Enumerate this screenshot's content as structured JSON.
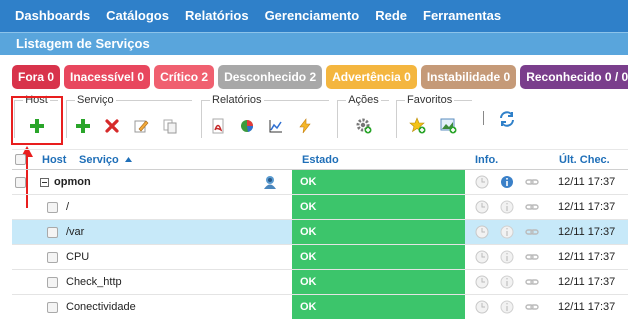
{
  "nav": [
    "Dashboards",
    "Catálogos",
    "Relatórios",
    "Gerenciamento",
    "Rede",
    "Ferramentas"
  ],
  "subheader": "Listagem de Serviços",
  "badges": [
    {
      "label": "Fora 0",
      "color": "#d8334b"
    },
    {
      "label": "Inacessível 0",
      "color": "#e8475e"
    },
    {
      "label": "Crítico 2",
      "color": "#f06070"
    },
    {
      "label": "Desconhecido 2",
      "color": "#a8a8a8"
    },
    {
      "label": "Advertência 0",
      "color": "#f4b63f"
    },
    {
      "label": "Instabilidade 0",
      "color": "#c59a78"
    },
    {
      "label": "Reconhecido 0 / 0",
      "color": "#7a3e8c"
    }
  ],
  "toolbar": {
    "host": "Host",
    "servico": "Serviço",
    "relatorios": "Relatórios",
    "acoes": "Ações",
    "favoritos": "Favoritos"
  },
  "grid": {
    "col_host": "Host",
    "col_servico": "Serviço",
    "col_estado": "Estado",
    "col_info": "Info.",
    "col_ult": "Últ. Chec.",
    "host_name": "opmon",
    "host_status": "OK",
    "host_time": "12/11 17:37",
    "rows": [
      {
        "name": "/",
        "status": "OK",
        "time": "12/11 17:37"
      },
      {
        "name": "/var",
        "status": "OK",
        "time": "12/11 17:37"
      },
      {
        "name": "CPU",
        "status": "OK",
        "time": "12/11 17:37"
      },
      {
        "name": "Check_http",
        "status": "OK",
        "time": "12/11 17:37"
      },
      {
        "name": "Conectividade",
        "status": "OK",
        "time": "12/11 17:37"
      }
    ]
  }
}
